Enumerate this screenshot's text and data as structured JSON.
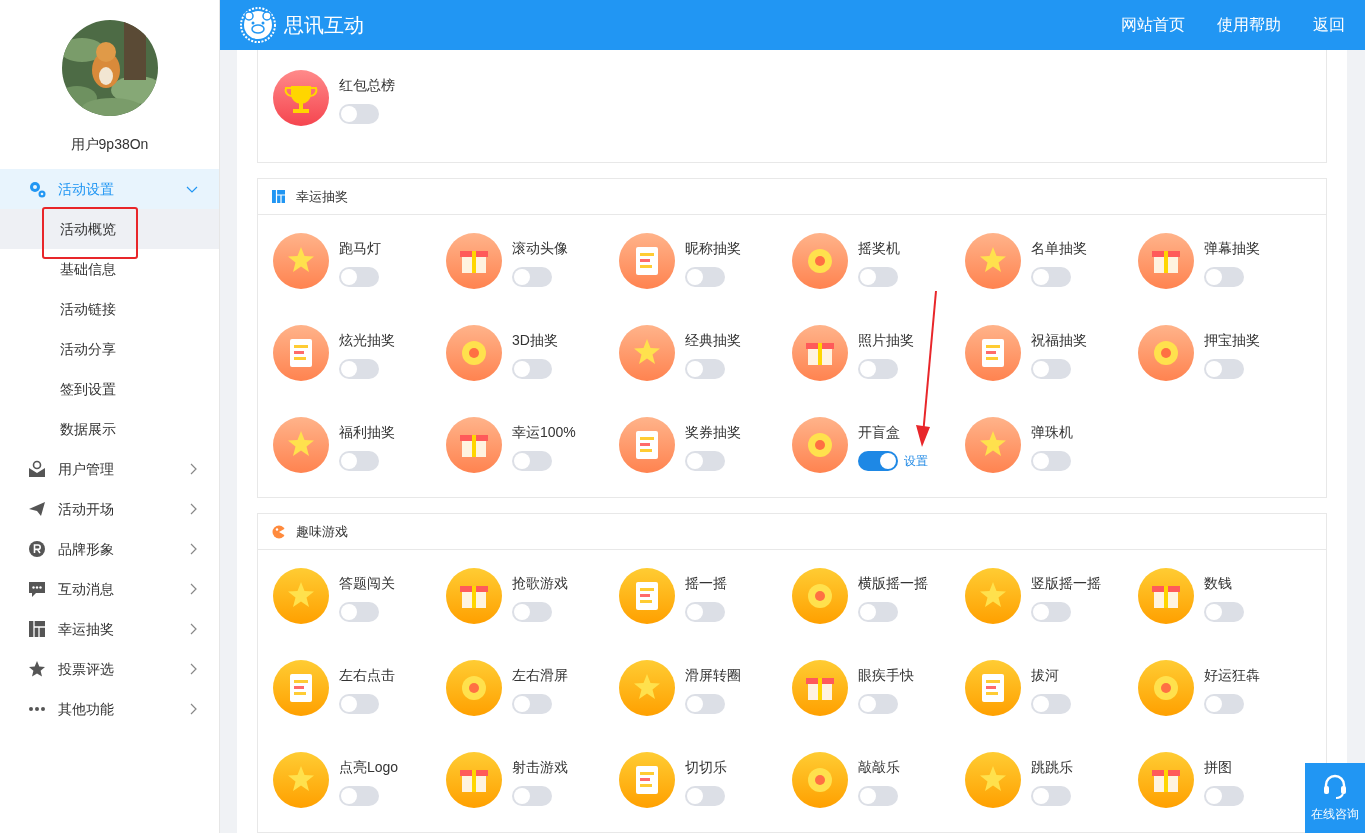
{
  "header": {
    "brand": "思讯互动",
    "links": [
      "网站首页",
      "使用帮助",
      "返回"
    ]
  },
  "user": {
    "name": "用户9p38On"
  },
  "menu": [
    {
      "label": "活动设置",
      "expanded": true,
      "selected": true,
      "children": [
        {
          "label": "活动概览",
          "selected": true,
          "annotated": true
        },
        {
          "label": "基础信息",
          "selected": false,
          "annotated": false
        },
        {
          "label": "活动链接",
          "selected": false,
          "annotated": false
        },
        {
          "label": "活动分享",
          "selected": false,
          "annotated": false
        },
        {
          "label": "签到设置",
          "selected": false,
          "annotated": false
        },
        {
          "label": "数据展示",
          "selected": false,
          "annotated": false
        }
      ]
    },
    {
      "label": "用户管理",
      "expanded": false,
      "selected": false
    },
    {
      "label": "活动开场",
      "expanded": false,
      "selected": false
    },
    {
      "label": "品牌形象",
      "expanded": false,
      "selected": false
    },
    {
      "label": "互动消息",
      "expanded": false,
      "selected": false
    },
    {
      "label": "幸运抽奖",
      "expanded": false,
      "selected": false
    },
    {
      "label": "投票评选",
      "expanded": false,
      "selected": false
    },
    {
      "label": "其他功能",
      "expanded": false,
      "selected": false
    }
  ],
  "sections": [
    {
      "kind": "ranking",
      "items": [
        {
          "label": "红包总榜",
          "on": false
        }
      ]
    },
    {
      "kind": "lottery",
      "title": "幸运抽奖",
      "items": [
        {
          "label": "跑马灯",
          "on": false
        },
        {
          "label": "滚动头像",
          "on": false
        },
        {
          "label": "昵称抽奖",
          "on": false
        },
        {
          "label": "摇奖机",
          "on": false
        },
        {
          "label": "名单抽奖",
          "on": false
        },
        {
          "label": "弹幕抽奖",
          "on": false
        },
        {
          "label": "炫光抽奖",
          "on": false
        },
        {
          "label": "3D抽奖",
          "on": false
        },
        {
          "label": "经典抽奖",
          "on": false
        },
        {
          "label": "照片抽奖",
          "on": false
        },
        {
          "label": "祝福抽奖",
          "on": false
        },
        {
          "label": "押宝抽奖",
          "on": false
        },
        {
          "label": "福利抽奖",
          "on": false
        },
        {
          "label": "幸运100%",
          "on": false
        },
        {
          "label": "奖券抽奖",
          "on": false
        },
        {
          "label": "开盲盒",
          "on": true,
          "settings_link": "设置",
          "annotated": true
        },
        {
          "label": "弹珠机",
          "on": false
        }
      ]
    },
    {
      "kind": "games",
      "title": "趣味游戏",
      "items": [
        {
          "label": "答题闯关",
          "on": false
        },
        {
          "label": "抢歌游戏",
          "on": false
        },
        {
          "label": "摇一摇",
          "on": false
        },
        {
          "label": "横版摇一摇",
          "on": false
        },
        {
          "label": "竖版摇一摇",
          "on": false
        },
        {
          "label": "数钱",
          "on": false
        },
        {
          "label": "左右点击",
          "on": false
        },
        {
          "label": "左右滑屏",
          "on": false
        },
        {
          "label": "滑屏转圈",
          "on": false
        },
        {
          "label": "眼疾手快",
          "on": false
        },
        {
          "label": "拔河",
          "on": false
        },
        {
          "label": "好运狂犇",
          "on": false
        },
        {
          "label": "点亮Logo",
          "on": false
        },
        {
          "label": "射击游戏",
          "on": false
        },
        {
          "label": "切切乐",
          "on": false
        },
        {
          "label": "敲敲乐",
          "on": false
        },
        {
          "label": "跳跳乐",
          "on": false
        },
        {
          "label": "拼图",
          "on": false
        }
      ]
    }
  ],
  "support": {
    "label": "在线咨询"
  }
}
